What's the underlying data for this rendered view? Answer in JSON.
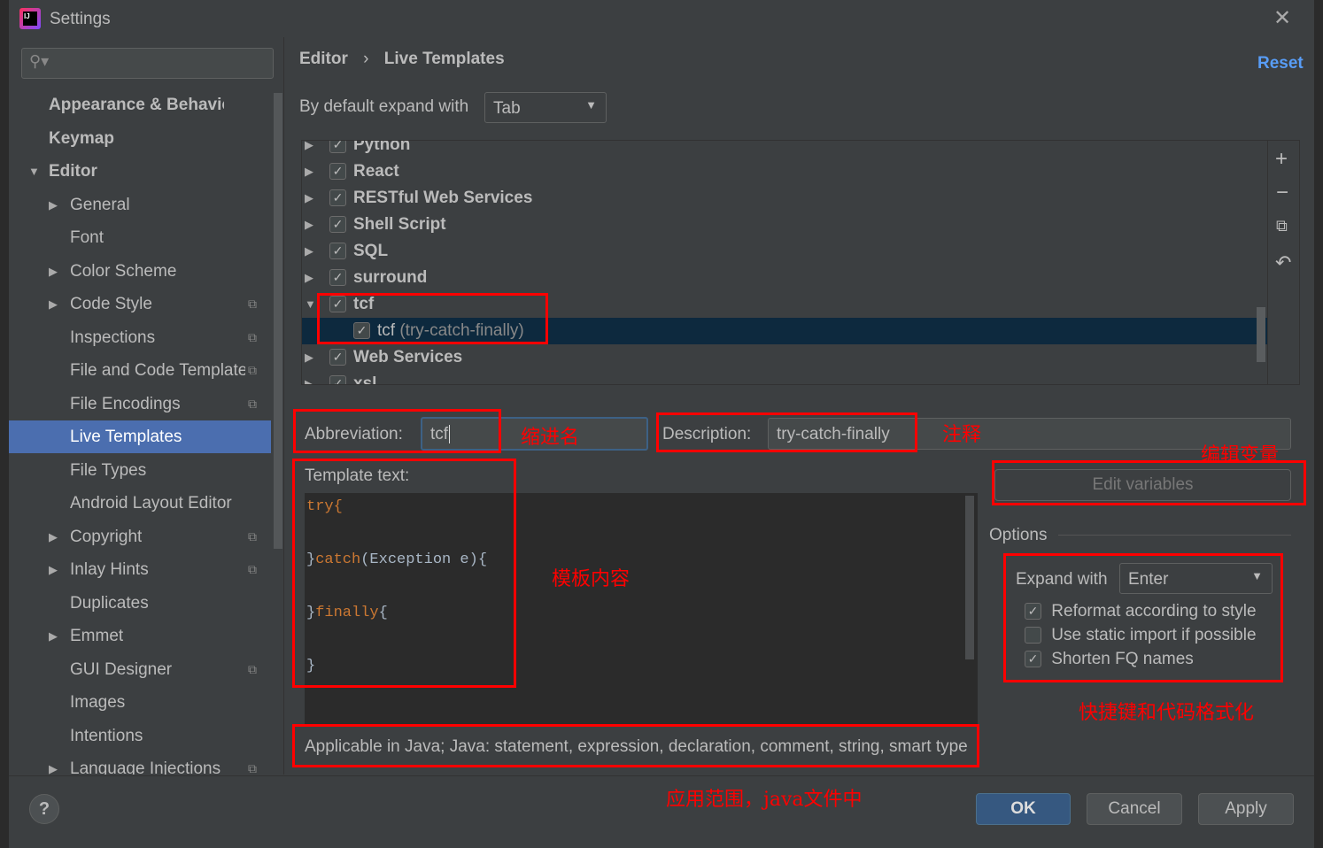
{
  "title": "Settings",
  "sidebar": {
    "search_placeholder": "",
    "items": [
      {
        "label": "Appearance & Behavior"
      },
      {
        "label": "Keymap"
      },
      {
        "label": "Editor"
      },
      {
        "label": "General"
      },
      {
        "label": "Font"
      },
      {
        "label": "Color Scheme"
      },
      {
        "label": "Code Style"
      },
      {
        "label": "Inspections"
      },
      {
        "label": "File and Code Templates"
      },
      {
        "label": "File Encodings"
      },
      {
        "label": "Live Templates"
      },
      {
        "label": "File Types"
      },
      {
        "label": "Android Layout Editor"
      },
      {
        "label": "Copyright"
      },
      {
        "label": "Inlay Hints"
      },
      {
        "label": "Duplicates"
      },
      {
        "label": "Emmet"
      },
      {
        "label": "GUI Designer"
      },
      {
        "label": "Images"
      },
      {
        "label": "Intentions"
      },
      {
        "label": "Language Injections"
      }
    ]
  },
  "breadcrumb": {
    "parent": "Editor",
    "sep": "›",
    "current": "Live Templates"
  },
  "reset": "Reset",
  "expand_default": {
    "label": "By default expand with",
    "value": "Tab"
  },
  "tree": [
    {
      "label": "Python",
      "checked": true
    },
    {
      "label": "React",
      "checked": true
    },
    {
      "label": "RESTful Web Services",
      "checked": true
    },
    {
      "label": "Shell Script",
      "checked": true
    },
    {
      "label": "SQL",
      "checked": true
    },
    {
      "label": "surround",
      "checked": true
    },
    {
      "label": "tcf",
      "checked": true,
      "expanded": true
    },
    {
      "label": "tcf",
      "desc": "(try-catch-finally)",
      "checked": true,
      "selected": true
    },
    {
      "label": "Web Services",
      "checked": true
    },
    {
      "label": "xsl",
      "checked": true
    }
  ],
  "abbreviation": {
    "label": "Abbreviation:",
    "value": "tcf"
  },
  "description": {
    "label": "Description:",
    "value": "try-catch-finally"
  },
  "edit_variables": "Edit variables",
  "template": {
    "label": "Template text:",
    "lines": [
      "try{",
      "}catch(Exception e){",
      "}finally{",
      "}"
    ]
  },
  "applicable": "Applicable in Java; Java: statement, expression, declaration, comment, string, smart type",
  "options": {
    "title": "Options",
    "expand_label": "Expand with",
    "expand_value": "Enter",
    "checks": [
      {
        "label": "Reformat according to style",
        "checked": true
      },
      {
        "label": "Use static import if possible",
        "checked": false
      },
      {
        "label": "Shorten FQ names",
        "checked": true
      }
    ]
  },
  "buttons": {
    "ok": "OK",
    "cancel": "Cancel",
    "apply": "Apply",
    "help": "?"
  },
  "annotations": {
    "abbr": "缩进名",
    "desc": "注释",
    "vars": "编辑变量",
    "template": "模板内容",
    "options": "快捷键和代码格式化",
    "applicable": "应用范围，java文件中"
  },
  "colors": {
    "accent": "#4b6eaf",
    "annotation": "#ff0000",
    "keyword": "#cc7832",
    "link": "#589df6"
  }
}
